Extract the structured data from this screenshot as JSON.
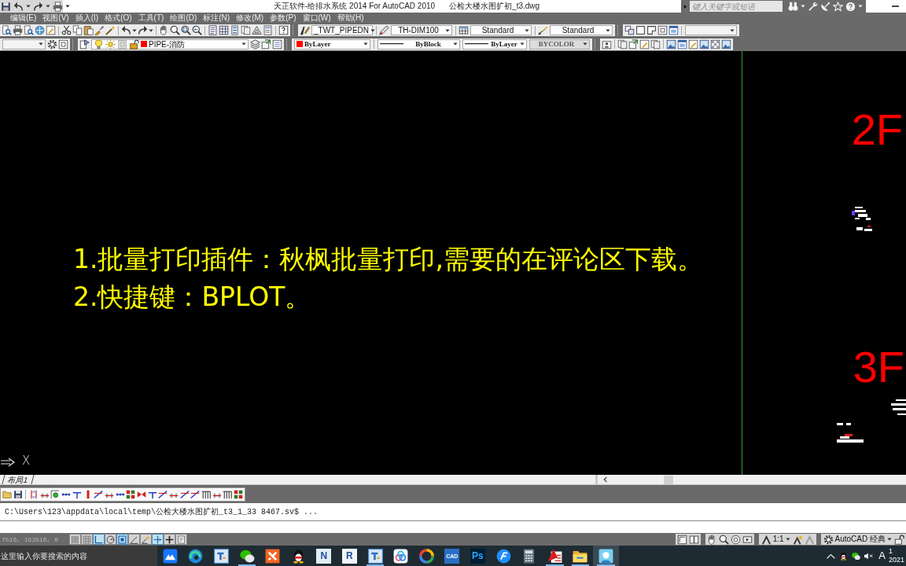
{
  "title_bar": {
    "window_title": "天正软件-给排水系统 2014 For AutoCAD 2010",
    "document_title": "公检大楼水图扩初_t3.dwg",
    "search": {
      "placeholder": "键入关键字或短语"
    }
  },
  "menu_bar": {
    "items": [
      "编辑(E)",
      "视图(V)",
      "插入(I)",
      "格式(O)",
      "工具(T)",
      "绘图(D)",
      "标注(N)",
      "修改(M)",
      "参数(P)",
      "窗口(W)",
      "帮助(H)"
    ]
  },
  "styles_toolbar": {
    "text_style": "_TWT_PIPEDN",
    "dimension_style": "TH-DIM100",
    "table_style": "Standard",
    "multileader_style": "Standard"
  },
  "properties_toolbar": {
    "layer": {
      "value": "PIPE-消防",
      "color": "#ff0000"
    },
    "color_control": {
      "value": "ByLayer",
      "color": "#ff0000"
    },
    "linetype": "ByBlock",
    "lineweight": "ByLayer",
    "plot_style": {
      "value": "BYCOLOR",
      "disabled": true
    }
  },
  "canvas": {
    "notes": [
      "1.批量打印插件：秋枫批量打印,需要的在评论区下载。",
      "2.快捷键：BPLOT。"
    ],
    "floor_labels": [
      "2F",
      "3F"
    ],
    "ucs_axis_label": "X"
  },
  "layout_tabs": [
    {
      "label": "布局1",
      "selected": false
    }
  ],
  "command_line": {
    "history": "C:\\Users\\123\\appdata\\local\\temp\\公检大楼水图扩初_t3_1_33 8467.sv$ ..."
  },
  "status_bar": {
    "coordinates": "7516, 163516, 0",
    "toggles": [
      {
        "on": false
      },
      {
        "on": false
      },
      {
        "on": true
      },
      {
        "on": false
      },
      {
        "on": true
      },
      {
        "on": false
      },
      {
        "on": false
      },
      {
        "on": true
      },
      {
        "on": false
      },
      {
        "on": false
      }
    ],
    "annotation_scale": "1:1",
    "workspace": "AutoCAD 经典"
  },
  "taskbar": {
    "search": {
      "placeholder": "这里输入你要搜索的内容"
    },
    "apps": [
      {
        "kind": "mountain-tile",
        "running": false,
        "selected": false
      },
      {
        "kind": "swirl",
        "running": false,
        "selected": false
      },
      {
        "kind": "document-tile",
        "running": false,
        "selected": false
      },
      {
        "kind": "chat",
        "running": true,
        "selected": false
      },
      {
        "kind": "cross-tile",
        "running": false,
        "selected": false
      },
      {
        "kind": "penguin",
        "running": false,
        "selected": false
      },
      {
        "kind": "letter-tile",
        "label": "N",
        "color": "#e3ecf5",
        "running": false,
        "selected": false
      },
      {
        "kind": "letter-tile",
        "label": "R",
        "color": "#f2f5fa",
        "running": false,
        "selected": false
      },
      {
        "kind": "document-tile",
        "running": true,
        "selected": false
      },
      {
        "kind": "linked-rings",
        "running": false,
        "selected": false
      },
      {
        "kind": "color-ring",
        "running": false,
        "selected": false
      },
      {
        "kind": "letter-tile",
        "label": "CAD",
        "color": "#2a6fc4",
        "running": false,
        "selected": false
      },
      {
        "kind": "letter-tile",
        "label": "Ps",
        "color": "#001e36",
        "running": false,
        "selected": false
      },
      {
        "kind": "disc",
        "running": false,
        "selected": false
      },
      {
        "kind": "calculator",
        "running": false,
        "selected": false
      },
      {
        "kind": "triangle-page",
        "running": true,
        "selected": false
      },
      {
        "kind": "folder",
        "running": true,
        "selected": false
      },
      {
        "kind": "figure-tile",
        "running": true,
        "selected": true
      }
    ],
    "tray": {
      "input_indicator": "A"
    },
    "clock": {
      "time": "1",
      "date": "2021"
    }
  }
}
